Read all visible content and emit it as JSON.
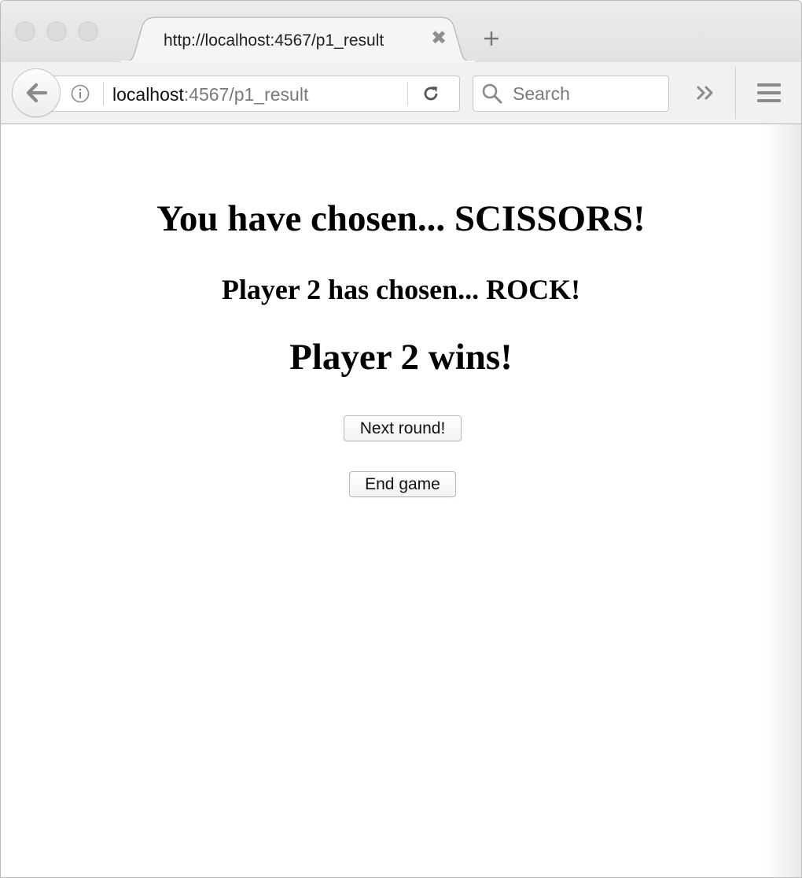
{
  "browser": {
    "tab": {
      "title": "http://localhost:4567/p1_result",
      "close_glyph": "✖"
    },
    "url": {
      "host": "localhost",
      "path": ":4567/p1_result"
    },
    "search": {
      "placeholder": "Search",
      "value": ""
    },
    "icons": {
      "back": "back-arrow-icon",
      "info": "info-icon",
      "reload": "reload-icon",
      "search": "search-icon",
      "overflow": "overflow-chevrons-icon",
      "menu": "hamburger-menu-icon",
      "new_tab": "plus-icon"
    }
  },
  "page": {
    "player_choice": "You have chosen... SCISSORS!",
    "opponent_choice": "Player 2 has chosen... ROCK!",
    "result": "Player 2 wins!",
    "next_round_label": "Next round!",
    "end_game_label": "End game"
  },
  "colors": {
    "chrome_background": "#ececec",
    "text": "#000000",
    "muted_url": "#7a7a7a"
  }
}
